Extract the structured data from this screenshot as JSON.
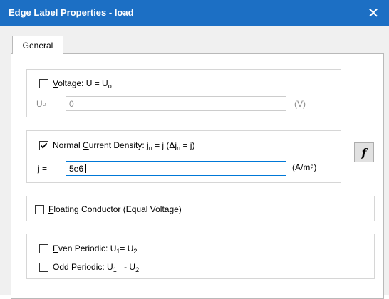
{
  "window": {
    "title": "Edge Label Properties - load",
    "close_glyph": "✕"
  },
  "tabs": [
    {
      "label": "General",
      "active": true
    }
  ],
  "voltage": {
    "checkbox_checked": false,
    "label_prefix": "",
    "label_mnemonic": "V",
    "label_rest": "oltage: U = U",
    "label_sub": "o",
    "field_label": "U",
    "field_label_sub": "o",
    "field_label_suffix": " =",
    "value": "0",
    "unit": "(V)",
    "enabled": false
  },
  "current_density": {
    "checkbox_checked": true,
    "label_prefix": "Normal ",
    "label_mnemonic": "C",
    "label_rest": "urrent Density: j",
    "label_sub1": "n",
    "label_mid": " = j (Δj",
    "label_sub2": "n",
    "label_end": " = j)",
    "field_label": "j =",
    "value": "5e6",
    "unit_prefix": "(A/m",
    "unit_sup": "2",
    "unit_suffix": ")"
  },
  "floating": {
    "checkbox_checked": false,
    "label_mnemonic": "F",
    "label_rest": "loating Conductor (Equal Voltage)"
  },
  "periodic": {
    "even_checked": false,
    "even_mnemonic": "E",
    "even_rest": "ven Periodic: U",
    "even_sub1": "1",
    "even_mid": "= U",
    "even_sub2": "2",
    "odd_checked": false,
    "odd_mnemonic": "O",
    "odd_rest": "dd Periodic: U",
    "odd_sub1": "1",
    "odd_mid": "= - U",
    "odd_sub2": "2"
  },
  "function_button": {
    "label": "f"
  },
  "colors": {
    "titlebar": "#1c6fc4",
    "focus_border": "#0078d7"
  }
}
